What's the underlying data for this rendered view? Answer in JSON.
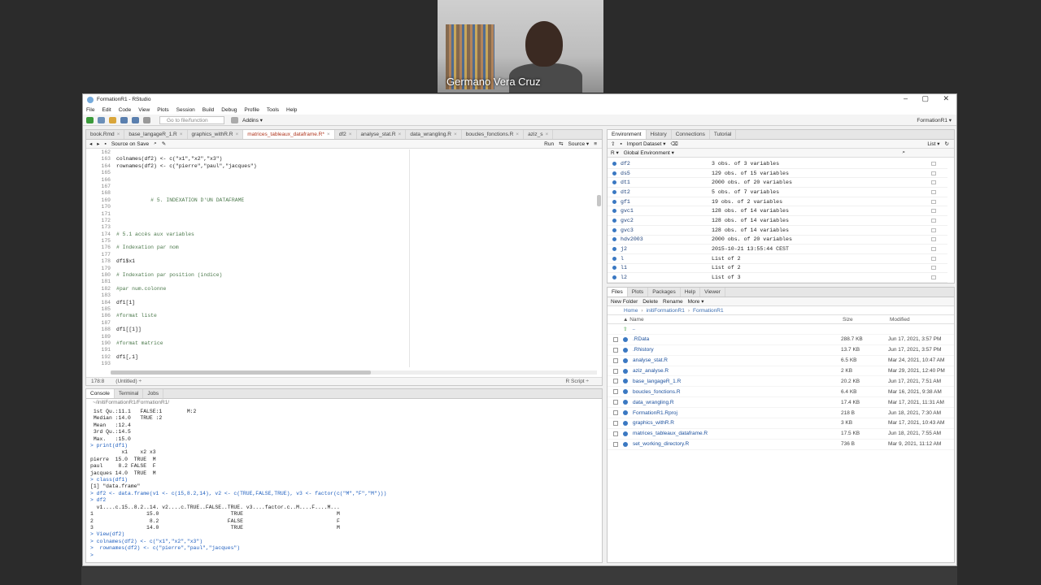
{
  "video": {
    "name": "Germano Vera Cruz"
  },
  "window": {
    "title": "FormationR1 - RStudio",
    "minimize": "–",
    "maximize": "▢",
    "close": "✕"
  },
  "menu": [
    "File",
    "Edit",
    "Code",
    "View",
    "Plots",
    "Session",
    "Build",
    "Debug",
    "Profile",
    "Tools",
    "Help"
  ],
  "toolbar": {
    "goto_placeholder": "Go to file/function",
    "addins": "Addins ▾",
    "project": "FormationR1 ▾"
  },
  "editor": {
    "tabs": [
      {
        "label": "book.Rmd",
        "active": false
      },
      {
        "label": "base_langageR_1.R",
        "active": false
      },
      {
        "label": "graphics_withR.R",
        "active": false
      },
      {
        "label": "matrices_tableaux_dataframe.R*",
        "active": true
      },
      {
        "label": "df2",
        "active": false
      },
      {
        "label": "analyse_stat.R",
        "active": false
      },
      {
        "label": "data_wrangling.R",
        "active": false
      },
      {
        "label": "boucles_fonctions.R",
        "active": false
      },
      {
        "label": "aziz_s",
        "active": false
      }
    ],
    "source_on_save": "Source on Save",
    "run": "Run",
    "source": "Source ▾",
    "line_numbers": [
      "162",
      "163",
      "164",
      "165",
      "166",
      "167",
      "168",
      "169",
      "170",
      "171",
      "172",
      "173",
      "174",
      "175",
      "176",
      "177",
      "178",
      "179",
      "180",
      "181",
      "182",
      "183",
      "184",
      "185",
      "186",
      "187",
      "188",
      "189",
      "190",
      "191",
      "192",
      "193",
      "194"
    ],
    "lines": [
      "",
      "colnames(df2) <- c(\"x1\",\"x2\",\"x3\")",
      "rownames(df2) <- c(\"pierre\",\"paul\",\"jacques\")",
      "",
      "",
      "",
      "",
      "           # 5. INDEXATION D'UN DATAFRAME",
      "",
      "",
      "",
      "",
      "# 5.1 accès aux variables",
      "",
      "# Indexation par nom",
      "",
      "df1$x1",
      "",
      "# Indexation par position (indice)",
      "",
      "#par num.colonne",
      "",
      "df1[1]",
      "",
      "#format liste",
      "",
      "df1[[1]]",
      "",
      "#format matrice",
      "",
      "df1[,1]",
      "",
      ""
    ],
    "status_position": "178:8",
    "status_scope": "(Untitled) ÷",
    "status_type": "R Script ÷"
  },
  "console": {
    "tabs": [
      "Console",
      "Terminal",
      "Jobs"
    ],
    "path": "~/initiFormationR1/FormationR1/",
    "output": [
      {
        "t": " 1st Qu.:11.1   FALSE:1        M:2",
        "c": "out"
      },
      {
        "t": " Median :14.0   TRUE :2",
        "c": "out"
      },
      {
        "t": " Mean   :12.4",
        "c": "out"
      },
      {
        "t": " 3rd Qu.:14.5",
        "c": "out"
      },
      {
        "t": " Max.   :15.0",
        "c": "out"
      },
      {
        "t": "> print(df1)",
        "c": "cmd"
      },
      {
        "t": "          x1    x2 x3",
        "c": "out"
      },
      {
        "t": "pierre  15.0  TRUE  M",
        "c": "out"
      },
      {
        "t": "paul     8.2 FALSE  F",
        "c": "out"
      },
      {
        "t": "jacques 14.0  TRUE  M",
        "c": "out"
      },
      {
        "t": "> class(df1)",
        "c": "cmd"
      },
      {
        "t": "[1] \"data.frame\"",
        "c": "out"
      },
      {
        "t": "> df2 <- data.frame(v1 <- c(15,8.2,14), v2 <- c(TRUE,FALSE,TRUE), v3 <- factor(c(\"M\",\"F\",\"M\")))",
        "c": "cmd"
      },
      {
        "t": "> df2",
        "c": "cmd"
      },
      {
        "t": "  v1....c.15..8.2..14. v2....c.TRUE..FALSE..TRUE. v3....factor.c..M....F....M...",
        "c": "out"
      },
      {
        "t": "1                 15.0                       TRUE                              M",
        "c": "out"
      },
      {
        "t": "2                  8.2                      FALSE                              F",
        "c": "out"
      },
      {
        "t": "3                 14.0                       TRUE                              M",
        "c": "out"
      },
      {
        "t": "> View(df2)",
        "c": "cmd"
      },
      {
        "t": "> colnames(df2) <- c(\"x1\",\"x2\",\"x3\")",
        "c": "cmd"
      },
      {
        "t": ">  rownames(df2) <- c(\"pierre\",\"paul\",\"jacques\")",
        "c": "cmd"
      },
      {
        "t": "> ",
        "c": "cmd"
      }
    ]
  },
  "env": {
    "tabs": [
      "Environment",
      "History",
      "Connections",
      "Tutorial"
    ],
    "import": "Import Dataset ▾",
    "list": "List ▾",
    "r": "R ▾",
    "scope": "Global Environment ▾",
    "rows": [
      {
        "name": "df2",
        "value": "3 obs. of 3 variables"
      },
      {
        "name": "ds5",
        "value": "129 obs. of 15 variables"
      },
      {
        "name": "dt1",
        "value": "2000 obs. of 20 variables"
      },
      {
        "name": "dt2",
        "value": "5 obs. of 7 variables"
      },
      {
        "name": "gf1",
        "value": "19 obs. of 2 variables"
      },
      {
        "name": "gvc1",
        "value": "128 obs. of 14 variables"
      },
      {
        "name": "gvc2",
        "value": "128 obs. of 14 variables"
      },
      {
        "name": "gvc3",
        "value": "128 obs. of 14 variables"
      },
      {
        "name": "hdv2003",
        "value": "2000 obs. of 20 variables"
      },
      {
        "name": "j2",
        "value": "2015-10-21 13:55:44 CEST"
      },
      {
        "name": "l",
        "value": "List of  2"
      },
      {
        "name": "l1",
        "value": "List of  2"
      },
      {
        "name": "l2",
        "value": "List of  3"
      }
    ]
  },
  "files": {
    "tabs": [
      "Files",
      "Plots",
      "Packages",
      "Help",
      "Viewer"
    ],
    "new_folder": "New Folder",
    "delete": "Delete",
    "rename": "Rename",
    "more": "More ▾",
    "breadcrumb": [
      "Home",
      "initiFormationR1",
      "FormationR1"
    ],
    "columns": {
      "name": "▲ Name",
      "size": "Size",
      "modified": "Modified"
    },
    "up": "..",
    "rows": [
      {
        "name": ".RData",
        "size": "288.7 KB",
        "modified": "Jun 17, 2021, 3:57 PM"
      },
      {
        "name": ".Rhistory",
        "size": "13.7 KB",
        "modified": "Jun 17, 2021, 3:57 PM"
      },
      {
        "name": "analyse_stat.R",
        "size": "6.5 KB",
        "modified": "Mar 24, 2021, 10:47 AM"
      },
      {
        "name": "aziz_analyse.R",
        "size": "2 KB",
        "modified": "Mar 29, 2021, 12:40 PM"
      },
      {
        "name": "base_langageR_1.R",
        "size": "20.2 KB",
        "modified": "Jun 17, 2021, 7:51 AM"
      },
      {
        "name": "boucles_fonctions.R",
        "size": "6.4 KB",
        "modified": "Mar 16, 2021, 9:38 AM"
      },
      {
        "name": "data_wrangling.R",
        "size": "17.4 KB",
        "modified": "Mar 17, 2021, 11:31 AM"
      },
      {
        "name": "FormationR1.Rproj",
        "size": "218 B",
        "modified": "Jun 18, 2021, 7:30 AM"
      },
      {
        "name": "graphics_withR.R",
        "size": "3 KB",
        "modified": "Mar 17, 2021, 10:43 AM"
      },
      {
        "name": "matrices_tableaux_dataframe.R",
        "size": "17.5 KB",
        "modified": "Jun 18, 2021, 7:55 AM"
      },
      {
        "name": "set_working_directory.R",
        "size": "736 B",
        "modified": "Mar 9, 2021, 11:12 AM"
      }
    ]
  }
}
